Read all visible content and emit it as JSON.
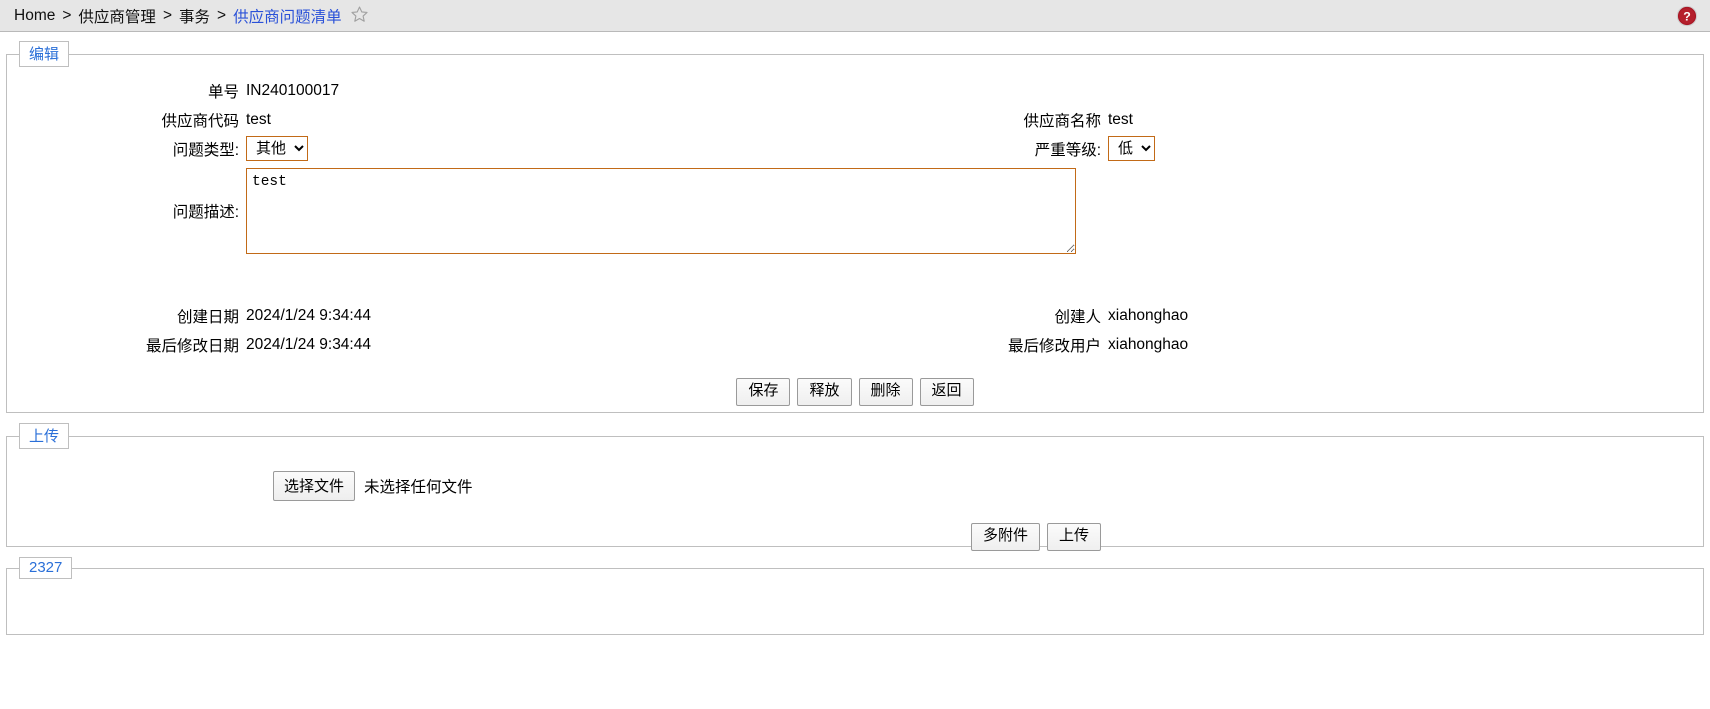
{
  "breadcrumb": {
    "items": [
      {
        "label": "Home",
        "active": false
      },
      {
        "label": "供应商管理",
        "active": false
      },
      {
        "label": "事务",
        "active": false
      },
      {
        "label": "供应商问题清单",
        "active": true
      }
    ],
    "separator": ">",
    "favorite_icon": "star-icon",
    "help_icon": "help-question-icon",
    "link_color": "#2a51d8"
  },
  "edit_panel": {
    "legend": "编辑",
    "legend_color": "#2a6fd8",
    "fields": {
      "order_no_label": "单号",
      "order_no_value": "IN240100017",
      "supplier_code_label": "供应商代码",
      "supplier_code_value": "test",
      "supplier_name_label": "供应商名称",
      "supplier_name_value": "test",
      "issue_type_label": "问题类型:",
      "issue_type_value": "其他",
      "issue_type_options": [
        "其他"
      ],
      "severity_label": "严重等级:",
      "severity_value": "低",
      "severity_options": [
        "低"
      ],
      "description_label": "问题描述:",
      "description_value": "test",
      "created_date_label": "创建日期",
      "created_date_value": "2024/1/24 9:34:44",
      "created_by_label": "创建人",
      "created_by_value": "xiahonghao",
      "modified_date_label": "最后修改日期",
      "modified_date_value": "2024/1/24 9:34:44",
      "modified_by_label": "最后修改用户",
      "modified_by_value": "xiahonghao"
    },
    "input_border_color": "#c26a17",
    "buttons": [
      {
        "label": "保存",
        "name": "save-button"
      },
      {
        "label": "释放",
        "name": "release-button"
      },
      {
        "label": "删除",
        "name": "delete-button"
      },
      {
        "label": "返回",
        "name": "back-button"
      }
    ]
  },
  "upload_panel": {
    "legend": "上传",
    "choose_file_label": "选择文件",
    "file_status": "未选择任何文件",
    "buttons": [
      {
        "label": "多附件",
        "name": "multi-attachment-button"
      },
      {
        "label": "上传",
        "name": "upload-button"
      }
    ]
  },
  "footer_panel": {
    "legend": "2327"
  }
}
